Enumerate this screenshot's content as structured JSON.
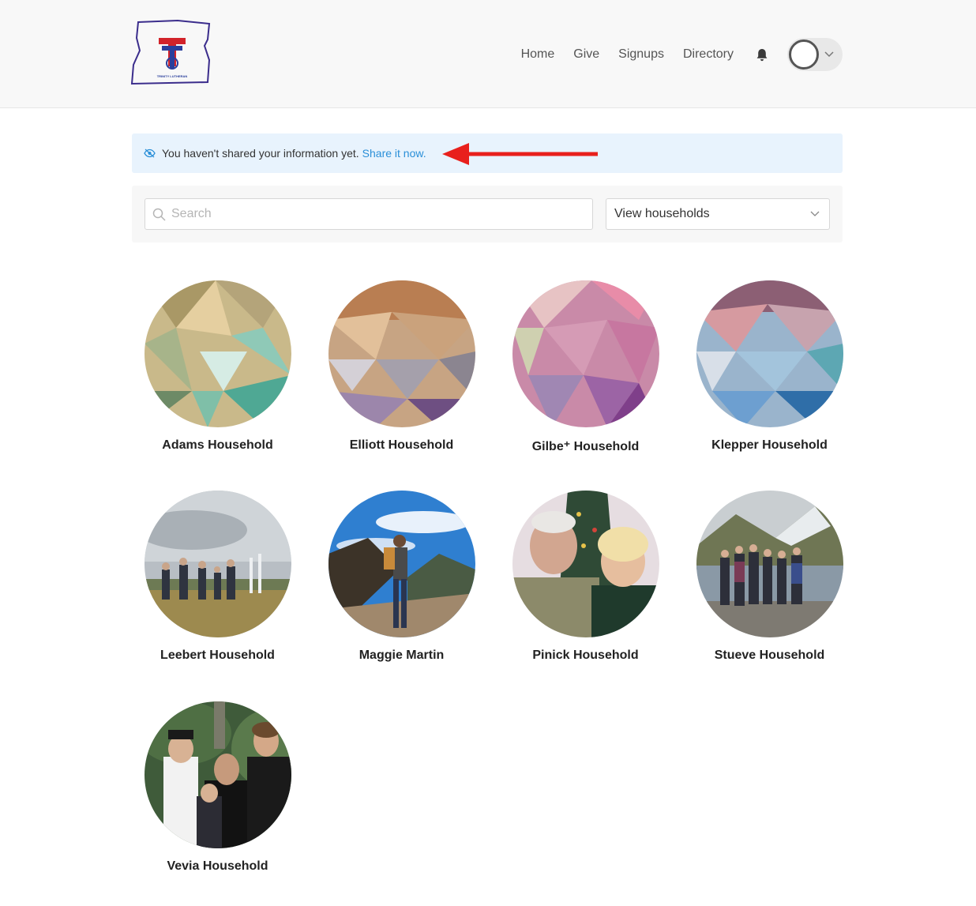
{
  "header": {
    "nav": [
      {
        "label": "Home"
      },
      {
        "label": "Give"
      },
      {
        "label": "Signups"
      },
      {
        "label": "Directory"
      }
    ],
    "logo_text": "TRINITY LUTHERAN"
  },
  "alert": {
    "message": "You haven't shared your information yet.",
    "link_label": "Share it now."
  },
  "search": {
    "placeholder": "Search",
    "view_select_value": "View households"
  },
  "colors": {
    "link": "#2a8fd8",
    "alert_bg": "#e8f3fd",
    "arrow": "#e8201c"
  },
  "households": [
    {
      "name": "Adams Household"
    },
    {
      "name": "Elliott Household"
    },
    {
      "name": "Gilbe⁺ Household"
    },
    {
      "name": "Klepper Household"
    },
    {
      "name": "Leebert Household"
    },
    {
      "name": "Maggie Martin"
    },
    {
      "name": "Pinick Household"
    },
    {
      "name": "Stueve Household"
    },
    {
      "name": "Vevia Household"
    }
  ]
}
